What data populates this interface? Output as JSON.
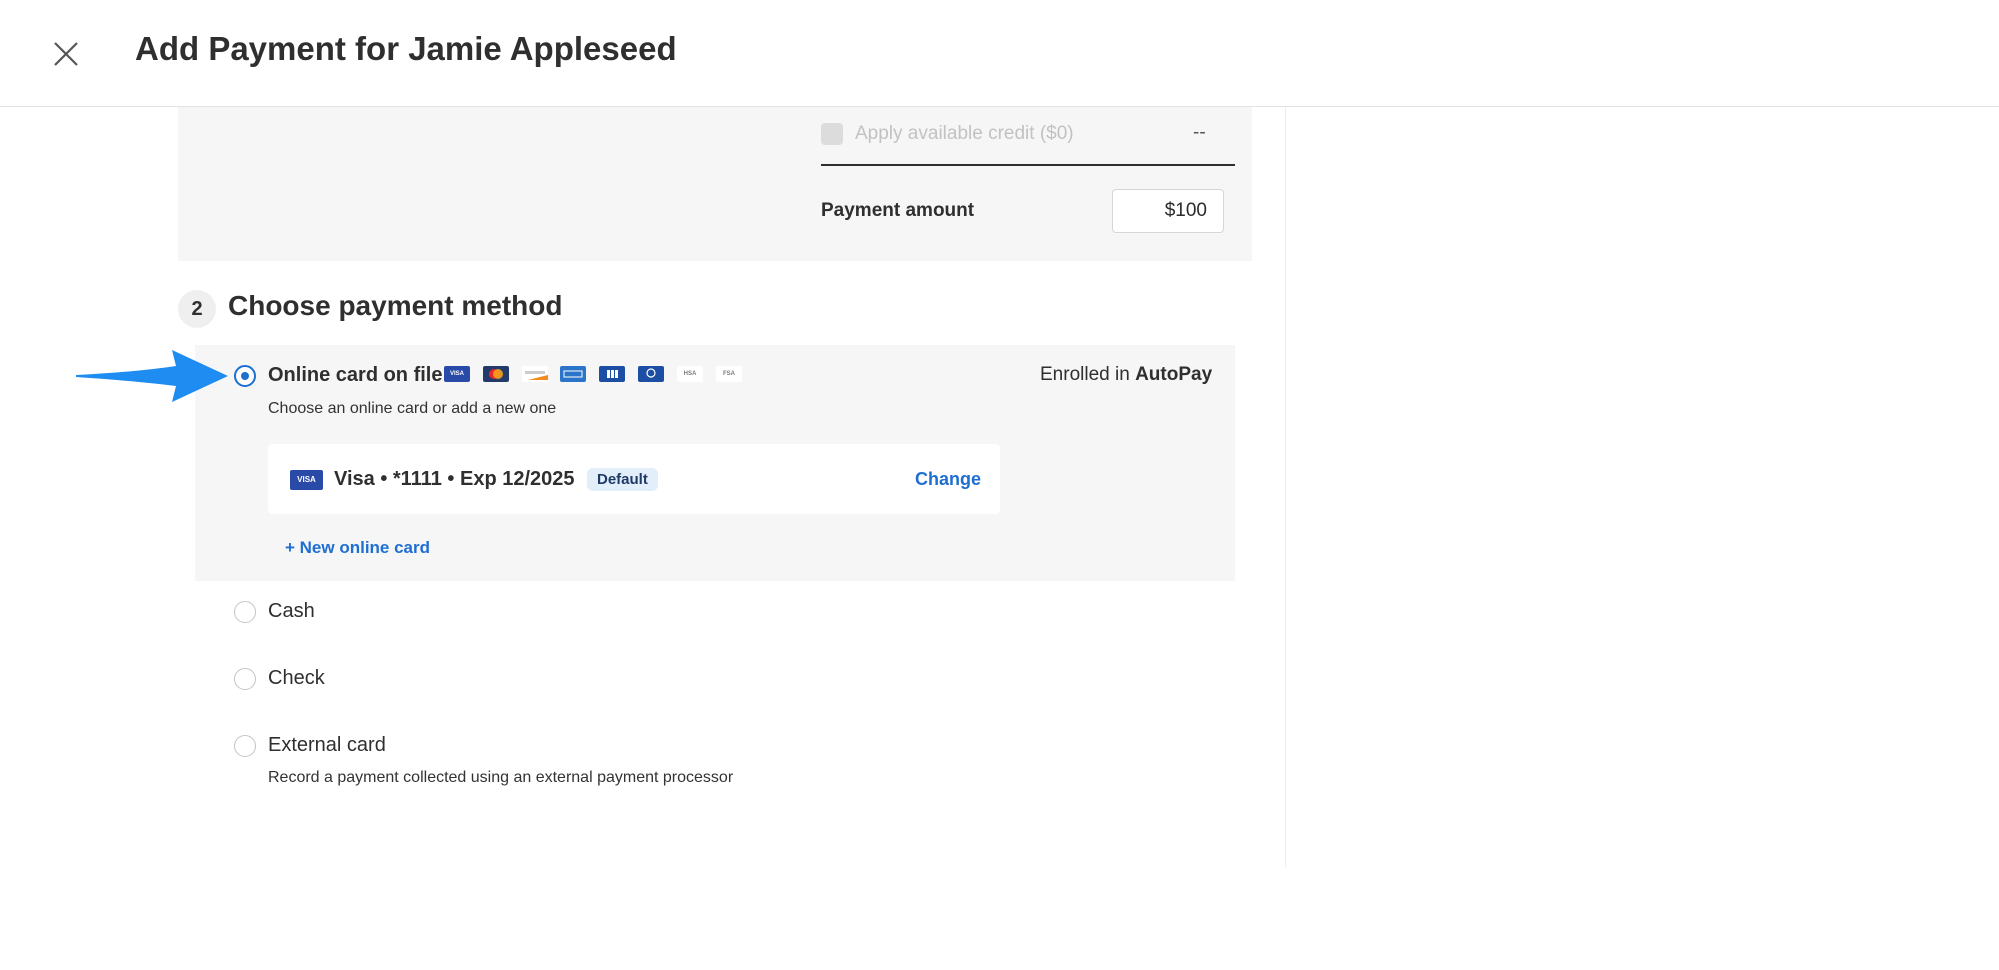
{
  "header": {
    "title": "Add Payment for Jamie Appleseed"
  },
  "summary": {
    "credit_label": "Apply available credit ($0)",
    "credit_value": "--",
    "payment_amount_label": "Payment amount",
    "payment_amount_value": "$100"
  },
  "step": {
    "number": "2",
    "title": "Choose payment method"
  },
  "payment_methods": {
    "online": {
      "label": "Online card on file",
      "description": "Choose an online card or add a new one",
      "selected": true,
      "autopay_prefix": "Enrolled in",
      "autopay_label": "AutoPay",
      "card_brands": [
        "visa-icon",
        "mastercard-icon",
        "discover-icon",
        "amex-icon",
        "jcb-icon",
        "diners-icon",
        "hsa-icon",
        "fsa-icon"
      ],
      "brand_text": {
        "visa": "VISA",
        "hsa": "HSA",
        "fsa": "FSA"
      },
      "saved_card": {
        "brand": "VISA",
        "text": "Visa • *1111 • Exp 12/2025",
        "badge": "Default",
        "change_label": "Change"
      },
      "new_card_label": "+ New online card"
    },
    "cash": {
      "label": "Cash"
    },
    "check": {
      "label": "Check"
    },
    "external": {
      "label": "External card",
      "description": "Record a payment collected using an external payment processor"
    }
  },
  "colors": {
    "accent": "#1f6fd1",
    "arrow": "#1e8cf0",
    "badge_bg": "#e3eefb"
  }
}
